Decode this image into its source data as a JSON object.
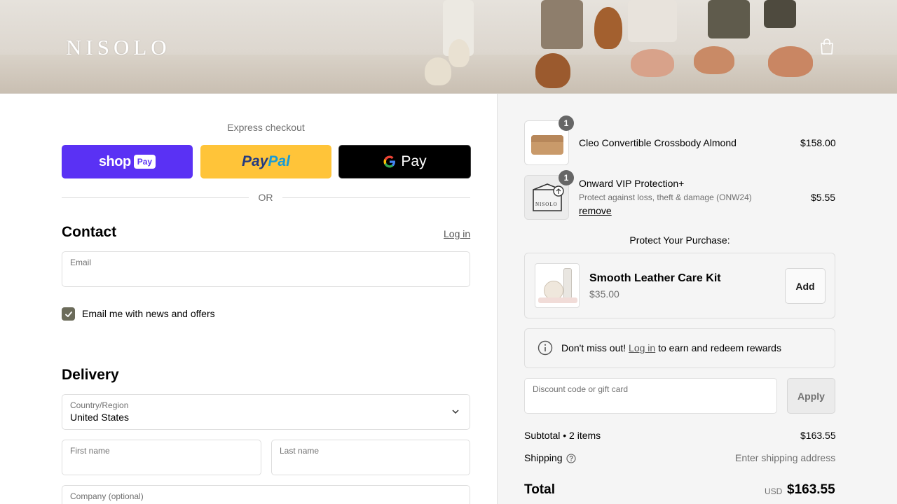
{
  "brand": {
    "logo": "NISOLO"
  },
  "express": {
    "title": "Express checkout",
    "shop_pay": {
      "shop": "shop",
      "pay": "Pay"
    },
    "paypal": {
      "p1": "Pay",
      "p2": "Pal"
    },
    "gpay": {
      "g": "G",
      "pay": "Pay"
    },
    "or": "OR"
  },
  "contact": {
    "title": "Contact",
    "login": "Log in",
    "email_label": "Email",
    "email_value": "",
    "newsletter_label": "Email me with news and offers",
    "newsletter_checked": true
  },
  "delivery": {
    "title": "Delivery",
    "country_label": "Country/Region",
    "country_value": "United States",
    "first_name_label": "First name",
    "last_name_label": "Last name",
    "company_label": "Company (optional)"
  },
  "cart": {
    "items": [
      {
        "qty": "1",
        "name": "Cleo Convertible Crossbody Almond",
        "price": "$158.00"
      },
      {
        "qty": "1",
        "name": "Onward VIP Protection+",
        "desc": "Protect against loss, theft & damage (ONW24)",
        "remove": "remove",
        "price": "$5.55",
        "thumb_text": "NISOLO"
      }
    ],
    "upsell": {
      "heading": "Protect Your Purchase:",
      "name": "Smooth Leather Care Kit",
      "price": "$35.00",
      "add": "Add"
    },
    "rewards": {
      "pre": "Don't miss out!",
      "login": "Log in",
      "post": "to earn and redeem rewards"
    },
    "discount": {
      "label": "Discount code or gift card",
      "apply": "Apply"
    },
    "subtotal": {
      "label": "Subtotal • 2 items",
      "value": "$163.55"
    },
    "shipping": {
      "label": "Shipping",
      "value": "Enter shipping address"
    },
    "total": {
      "label": "Total",
      "currency": "USD",
      "value": "$163.55"
    }
  },
  "colors": {
    "shop_pay": "#5a31f4",
    "paypal": "#ffc439",
    "checkbox": "#6b6b5a",
    "summary_bg": "#f5f5f5"
  }
}
